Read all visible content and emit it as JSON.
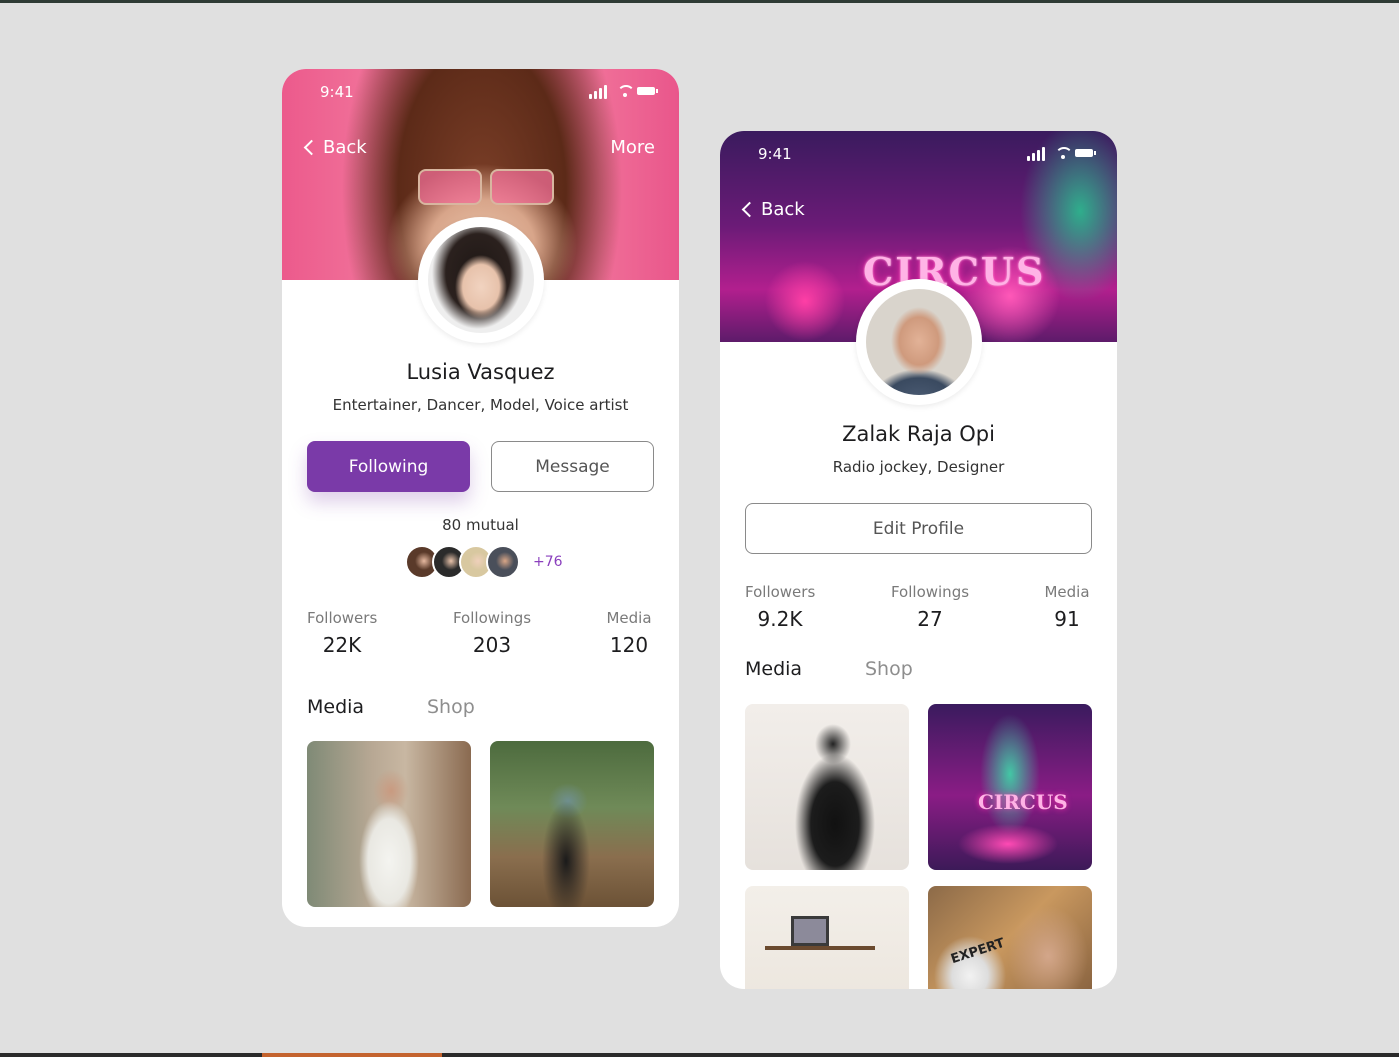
{
  "profiles": [
    {
      "status_time": "9:41",
      "back_label": "Back",
      "more_label": "More",
      "name": "Lusia Vasquez",
      "subtitle": "Entertainer, Dancer, Model, Voice artist",
      "primary_button": "Following",
      "secondary_button": "Message",
      "mutual_label": "80 mutual",
      "mutual_more": "+76",
      "stats": [
        {
          "label": "Followers",
          "value": "22K"
        },
        {
          "label": "Followings",
          "value": "203"
        },
        {
          "label": "Media",
          "value": "120"
        }
      ],
      "tabs": [
        "Media",
        "Shop"
      ]
    },
    {
      "status_time": "9:41",
      "back_label": "Back",
      "name": "Zalak Raja Opi",
      "subtitle": "Radio jockey, Designer",
      "edit_button": "Edit Profile",
      "hero_sign": "CIRCUS",
      "stats": [
        {
          "label": "Followers",
          "value": "9.2K"
        },
        {
          "label": "Followings",
          "value": "27"
        },
        {
          "label": "Media",
          "value": "91"
        }
      ],
      "tabs": [
        "Media",
        "Shop"
      ],
      "tile_sign": "CIRCUS",
      "book_title": "EXPERT"
    }
  ],
  "colors": {
    "accent": "#7a3aa8",
    "mutual_count": "#8a3fbd",
    "background": "#e0e0e0"
  },
  "icons": [
    "chevron-left-icon",
    "signal-icon",
    "wifi-icon",
    "battery-icon"
  ]
}
